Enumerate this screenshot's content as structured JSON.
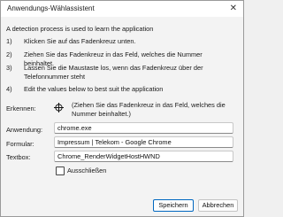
{
  "window": {
    "title": "Anwendungs-Wählassistent"
  },
  "intro": "A detection process is used to learn the application",
  "steps": [
    {
      "num": "1)",
      "text": "Klicken Sie auf das Fadenkreuz unten."
    },
    {
      "num": "2)",
      "text": "Ziehen Sie das Fadenkreuz in das Feld, welches die Nummer beinhaltet."
    },
    {
      "num": "3)",
      "text": "Lassen Sie die Maustaste los, wenn das Fadenkreuz über der Telefonnummer steht"
    },
    {
      "num": "4)",
      "text": "Edit the values below to best suit the application"
    }
  ],
  "detect": {
    "label": "Erkennen:",
    "hint": "(Ziehen Sie das Fadenkreuz in das Feld, welches die Nummer beinhaltet.)",
    "icon": "crosshair-icon"
  },
  "fields": {
    "application_label": "Anwendung:",
    "application_value": "chrome.exe",
    "form_label": "Formular:",
    "form_value": "Impressum | Telekom - Google Chrome",
    "textbox_label": "Textbox:",
    "textbox_value": "Chrome_RenderWidgetHostHWND"
  },
  "exclude": {
    "label": "Ausschließen",
    "checked": false
  },
  "buttons": {
    "save": "Speichern",
    "cancel": "Abbrechen"
  },
  "colors": {
    "accent": "#0067c0"
  }
}
